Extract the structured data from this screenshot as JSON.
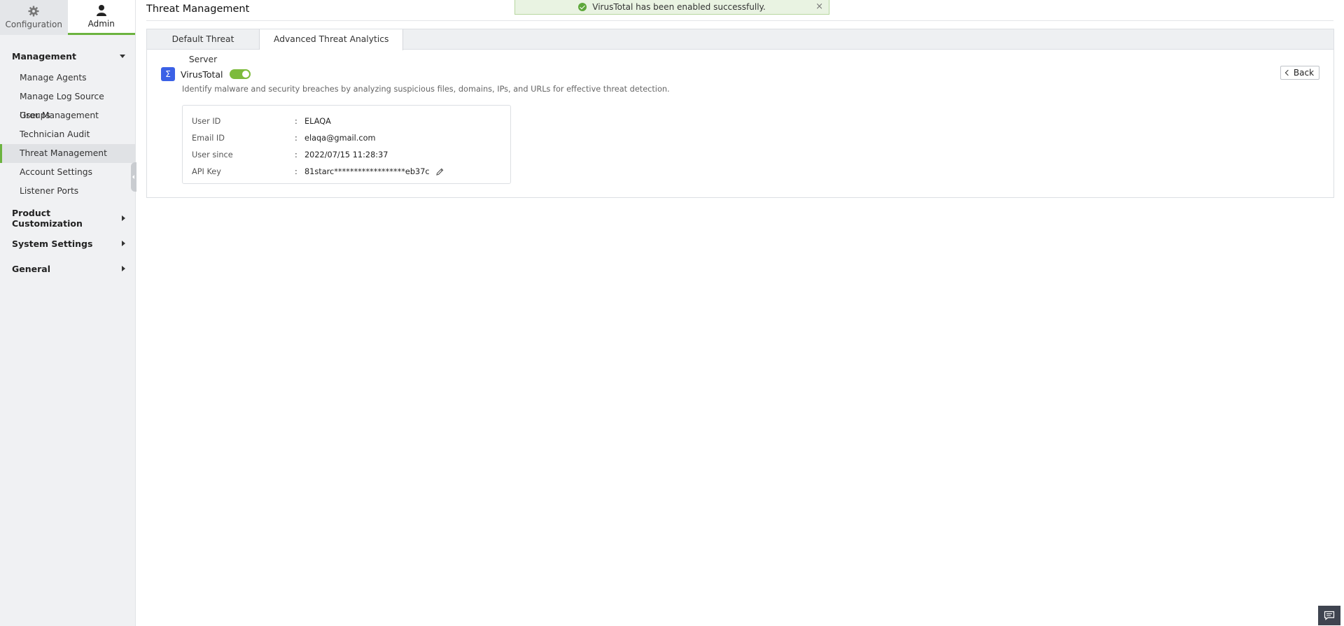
{
  "sidebar": {
    "top_tabs": [
      {
        "label": "Configuration",
        "icon": "gear-icon"
      },
      {
        "label": "Admin",
        "icon": "user-icon"
      }
    ],
    "management": {
      "title": "Management",
      "items": [
        {
          "label": "Manage Agents"
        },
        {
          "label": "Manage Log Source Groups"
        },
        {
          "label": "User Management"
        },
        {
          "label": "Technician Audit"
        },
        {
          "label": "Threat Management"
        },
        {
          "label": "Account Settings"
        },
        {
          "label": "Listener Ports"
        }
      ]
    },
    "collapsed_sections": [
      {
        "label": "Product Customization"
      },
      {
        "label": "System Settings"
      },
      {
        "label": "General"
      }
    ]
  },
  "page": {
    "title": "Threat Management"
  },
  "toast": {
    "message": "VirusTotal has been enabled successfully.",
    "close": "×"
  },
  "tabs": [
    {
      "label": "Default Threat Server"
    },
    {
      "label": "Advanced Threat Analytics"
    }
  ],
  "virustotal": {
    "logo_glyph": "Σ",
    "name": "VirusTotal",
    "enabled": true,
    "description": "Identify malware and security breaches by analyzing suspicious files, domains, IPs, and URLs for effective threat detection.",
    "back_label": "Back",
    "details": [
      {
        "label": "User ID",
        "value": "ELAQA"
      },
      {
        "label": "Email ID",
        "value": "elaqa@gmail.com"
      },
      {
        "label": "User since",
        "value": "2022/07/15 11:28:37"
      },
      {
        "label": "API Key",
        "value": "81starc******************eb37c"
      }
    ],
    "colon": ":"
  },
  "colors": {
    "accent_green": "#6cb33f",
    "toggle_green": "#7dbb3c",
    "vt_blue": "#3b61e6"
  }
}
